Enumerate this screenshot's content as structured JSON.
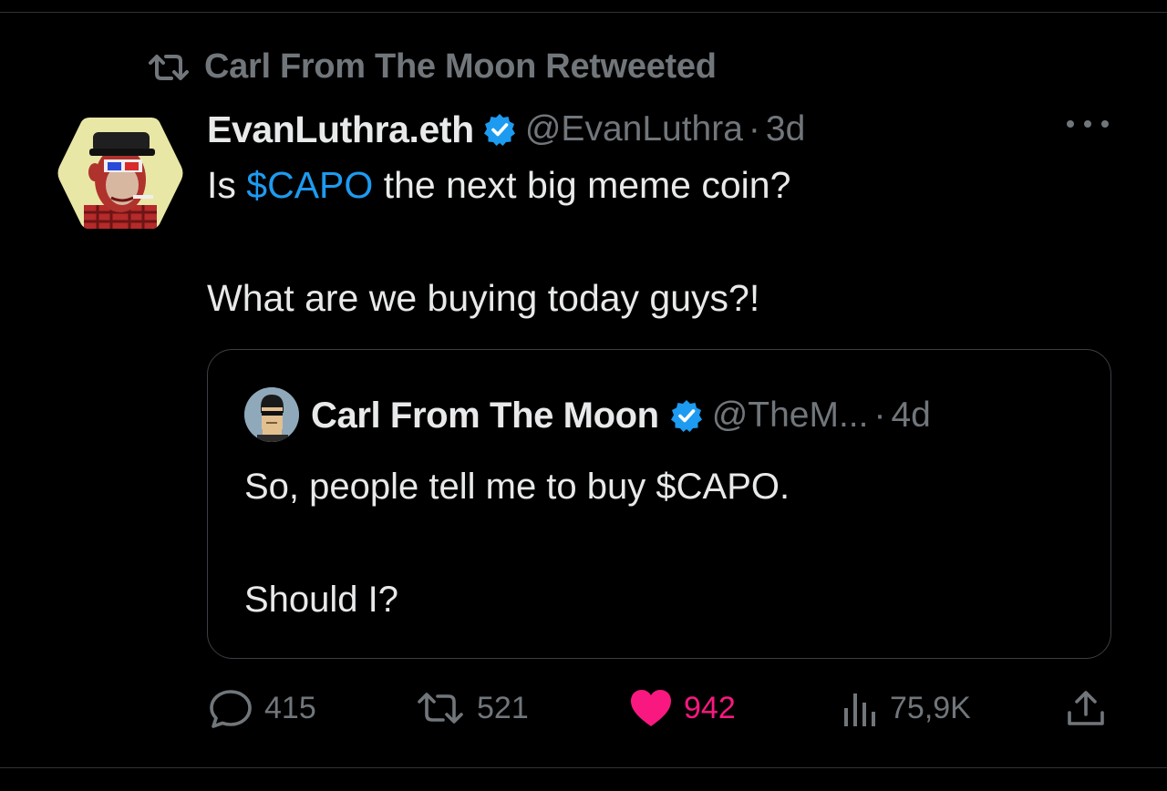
{
  "retweet_banner": {
    "text": "Carl From The Moon Retweeted"
  },
  "tweet": {
    "author_name": "EvanLuthra.eth",
    "handle": "@EvanLuthra",
    "separator": "·",
    "time": "3d",
    "line1_prefix": "Is ",
    "line1_cashtag": "$CAPO",
    "line1_suffix": " the next big meme coin?",
    "line2": "What are we buying today guys?!"
  },
  "quoted_tweet": {
    "author_name": "Carl From The Moon",
    "handle": "@TheM...",
    "separator": "·",
    "time": "4d",
    "line1": "So, people tell me to buy $CAPO.",
    "line2": "Should I?"
  },
  "actions": {
    "replies": "415",
    "retweets": "521",
    "likes": "942",
    "views": "75,9K"
  },
  "colors": {
    "background": "#000000",
    "text_primary": "#e7e9ea",
    "text_secondary": "#71767b",
    "accent_link": "#1d9bf0",
    "like_active": "#f91880",
    "verified_badge": "#1d9bf0"
  },
  "icons": {
    "retweet_banner": "retweet-icon",
    "verified": "verified-badge-icon",
    "more": "more-icon",
    "reply": "reply-icon",
    "retweet": "retweet-icon",
    "like": "heart-icon",
    "views": "views-icon",
    "share": "share-icon"
  }
}
